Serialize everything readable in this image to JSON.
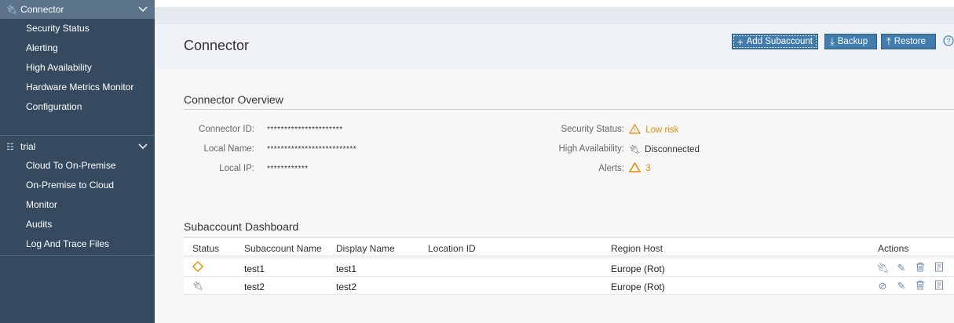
{
  "sidebar": {
    "connector_group": {
      "label": "Connector"
    },
    "connector_items": [
      {
        "label": "Security Status"
      },
      {
        "label": "Alerting"
      },
      {
        "label": "High Availability"
      },
      {
        "label": "Hardware Metrics Monitor"
      },
      {
        "label": "Configuration"
      }
    ],
    "trial_group": {
      "label": "trial"
    },
    "trial_items": [
      {
        "label": "Cloud To On-Premise"
      },
      {
        "label": "On-Premise to Cloud"
      },
      {
        "label": "Monitor"
      },
      {
        "label": "Audits"
      },
      {
        "label": "Log And Trace Files"
      }
    ]
  },
  "header": {
    "title": "Connector",
    "add_subaccount": "Add Subaccount",
    "backup": "Backup",
    "restore": "Restore"
  },
  "overview": {
    "title": "Connector Overview",
    "connector_id_label": "Connector ID:",
    "connector_id_value": "**********************",
    "local_name_label": "Local Name:",
    "local_name_value": "**************************",
    "local_ip_label": "Local IP:",
    "local_ip_value": "************",
    "security_status_label": "Security Status:",
    "security_status_value": "Low risk",
    "high_availability_label": "High Availability:",
    "high_availability_value": "Disconnected",
    "alerts_label": "Alerts:",
    "alerts_value": "3"
  },
  "dashboard": {
    "title": "Subaccount Dashboard",
    "columns": [
      "Status",
      "Subaccount Name",
      "Display Name",
      "Location ID",
      "Region Host",
      "Actions"
    ],
    "rows": [
      {
        "status_icon": "diamond-warning-icon",
        "subaccount": "test1",
        "display": "test1",
        "location": "",
        "region": "Europe (Rot)"
      },
      {
        "status_icon": "disconnected-icon",
        "subaccount": "test2",
        "display": "test2",
        "location": "",
        "region": "Europe (Rot)"
      }
    ]
  },
  "colors": {
    "sidebar_bg": "#354a5f",
    "sidebar_active": "#5b738b",
    "accent": "#427cac",
    "warning": "#e78c07"
  }
}
